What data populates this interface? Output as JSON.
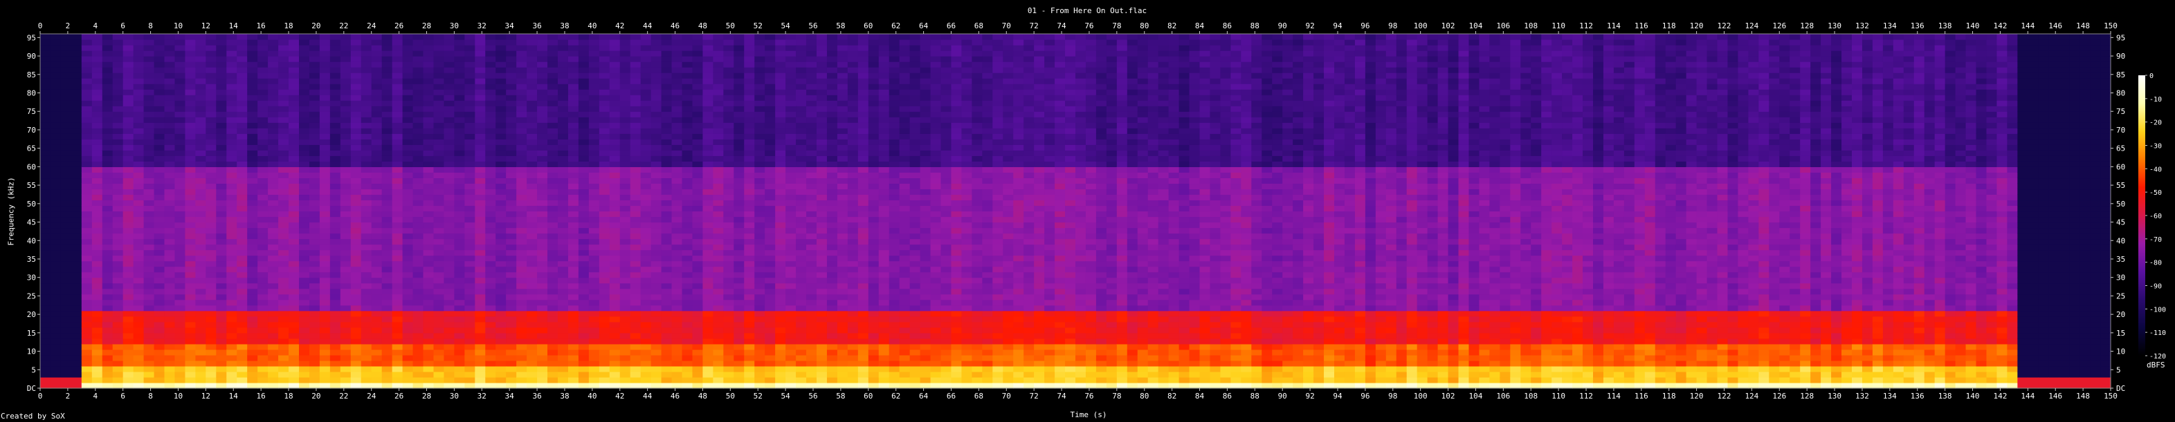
{
  "chart_data": {
    "type": "heatmap",
    "title": "01 - From Here On Out.flac",
    "xlabel": "Time (s)",
    "ylabel": "Frequency (kHz)",
    "xlim": [
      0,
      150
    ],
    "ylim": [
      0,
      96
    ],
    "x_ticks": [
      0,
      2,
      4,
      6,
      8,
      10,
      12,
      14,
      16,
      18,
      20,
      22,
      24,
      26,
      28,
      30,
      32,
      34,
      36,
      38,
      40,
      42,
      44,
      46,
      48,
      50,
      52,
      54,
      56,
      58,
      60,
      62,
      64,
      66,
      68,
      70,
      72,
      74,
      76,
      78,
      80,
      82,
      84,
      86,
      88,
      90,
      92,
      94,
      96,
      98,
      100,
      102,
      104,
      106,
      108,
      110,
      112,
      114,
      116,
      118,
      120,
      122,
      124,
      126,
      128,
      130,
      132,
      134,
      136,
      138,
      140,
      142,
      144,
      146,
      148,
      150
    ],
    "y_ticks": [
      "DC",
      5,
      10,
      15,
      20,
      25,
      30,
      35,
      40,
      45,
      50,
      55,
      60,
      65,
      70,
      75,
      80,
      85,
      90,
      95
    ],
    "colorbar": {
      "label": "dBFS",
      "ticks": [
        0,
        -10,
        -20,
        -30,
        -40,
        -50,
        -60,
        -70,
        -80,
        -90,
        -100,
        -110,
        -120
      ],
      "range": [
        -120,
        0
      ]
    },
    "grid": false,
    "energy_bands_kHz": [
      {
        "upper": 2,
        "level_dBFS": -10
      },
      {
        "upper": 6,
        "level_dBFS": -25
      },
      {
        "upper": 12,
        "level_dBFS": -40
      },
      {
        "upper": 21,
        "level_dBFS": -52
      },
      {
        "upper": 60,
        "level_dBFS": -75
      },
      {
        "upper": 96,
        "level_dBFS": -90
      }
    ],
    "audio_active_range_s": [
      3.0,
      143.5
    ]
  },
  "footer": {
    "credit": "Created by SoX"
  },
  "colors": {
    "background": "#000000",
    "colormap": [
      "#000000",
      "#0b0640",
      "#2a0a6e",
      "#5a10a0",
      "#9a1aa8",
      "#d8184a",
      "#ff1a00",
      "#ff7a00",
      "#ffd21a",
      "#ffffb0",
      "#ffffff"
    ]
  }
}
